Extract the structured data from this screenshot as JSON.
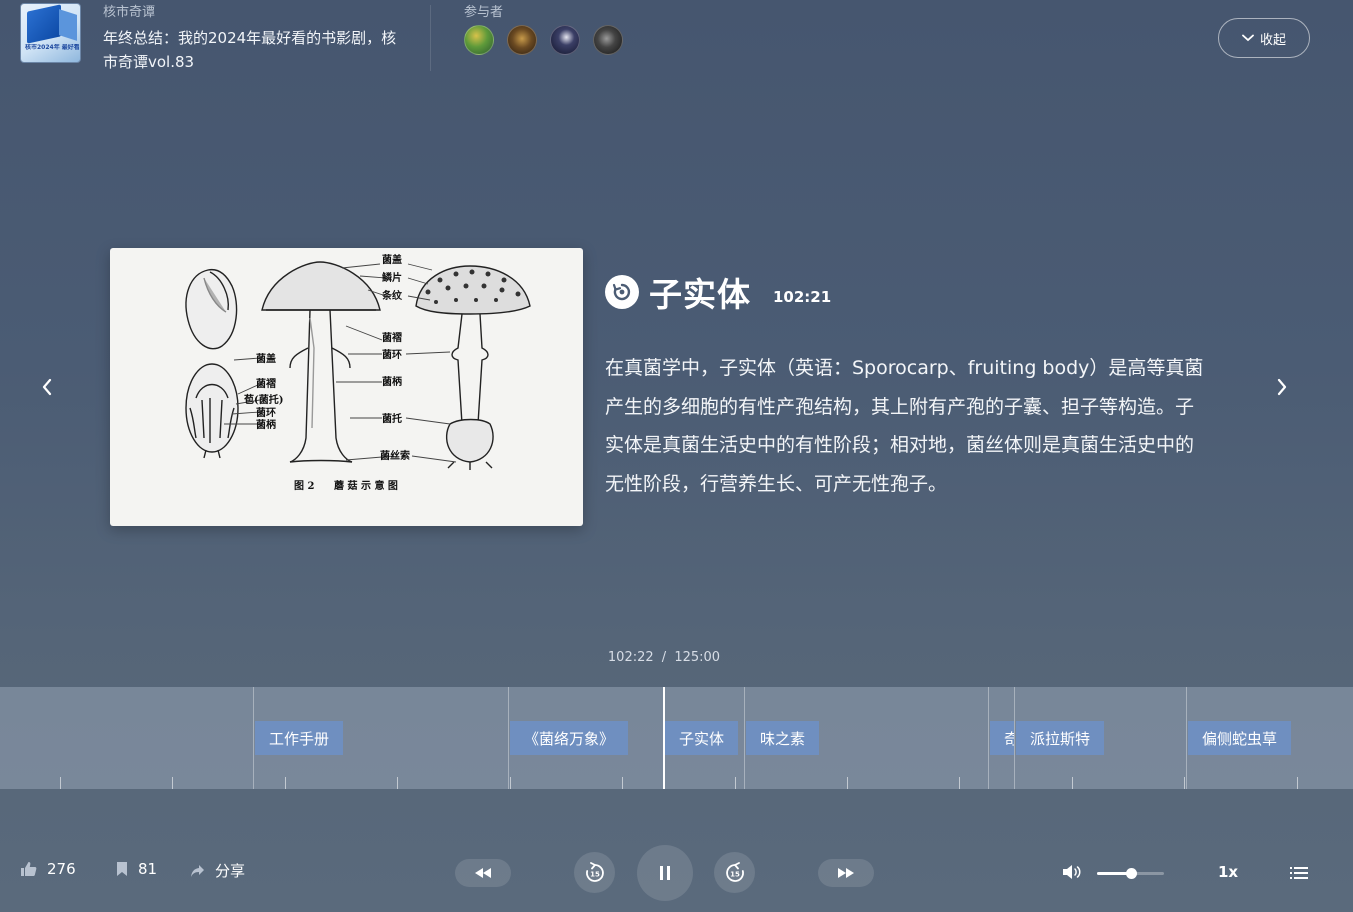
{
  "header": {
    "podcast_name": "核市奇谭",
    "episode_title": "年终总结：我的2024年最好看的书影剧，核市奇谭vol.83",
    "cover_text": "核市2024年 最好看的书影剧",
    "participants_label": "参与者",
    "collapse_label": "收起"
  },
  "chapter": {
    "title": "子实体",
    "time": "102:21",
    "description": "在真菌学中，子实体（英语：Sporocarp、fruiting body）是高等真菌产生的多细胞的有性产孢结构，其上附有产孢的子囊、担子等构造。子实体是真菌生活史中的有性阶段；相对地，菌丝体则是真菌生活史中的无性阶段，行营养生长、可产无性孢子。"
  },
  "figure": {
    "labels": [
      "菌盖",
      "鳞片",
      "条纹",
      "菌褶",
      "菌环",
      "菌柄",
      "菌托",
      "菌丝索",
      "菌盖",
      "菌褶",
      "苞(菌托)",
      "菌环",
      "菌柄"
    ],
    "caption_num": "图 2",
    "caption_text": "蘑 菇 示 意 图"
  },
  "playback": {
    "current": "102:22",
    "separator": "/",
    "total": "125:00",
    "progress_fraction": 0.8176,
    "volume_fraction": 0.5,
    "speed": "1x"
  },
  "timeline": {
    "chapters": [
      {
        "label": "工作手册"
      },
      {
        "label": "《菌络万象》"
      },
      {
        "label": "子实体"
      },
      {
        "label": "味之素"
      },
      {
        "label": "奇"
      },
      {
        "label": "派拉斯特"
      },
      {
        "label": "偏侧蛇虫草"
      }
    ]
  },
  "stats": {
    "likes": "276",
    "bookmarks": "81",
    "share_label": "分享"
  },
  "icons": {
    "like": "thumbs-up-icon",
    "bookmark": "bookmark-icon",
    "share": "share-icon",
    "rewind": "rewind-icon",
    "back15": "rewind-15-icon",
    "pause": "pause-icon",
    "forward15": "forward-15-icon",
    "fast_forward": "fast-forward-icon",
    "volume": "volume-icon",
    "playlist": "playlist-icon"
  },
  "colors": {
    "chip": "#6f8fc0",
    "background": "#4b5c74"
  }
}
